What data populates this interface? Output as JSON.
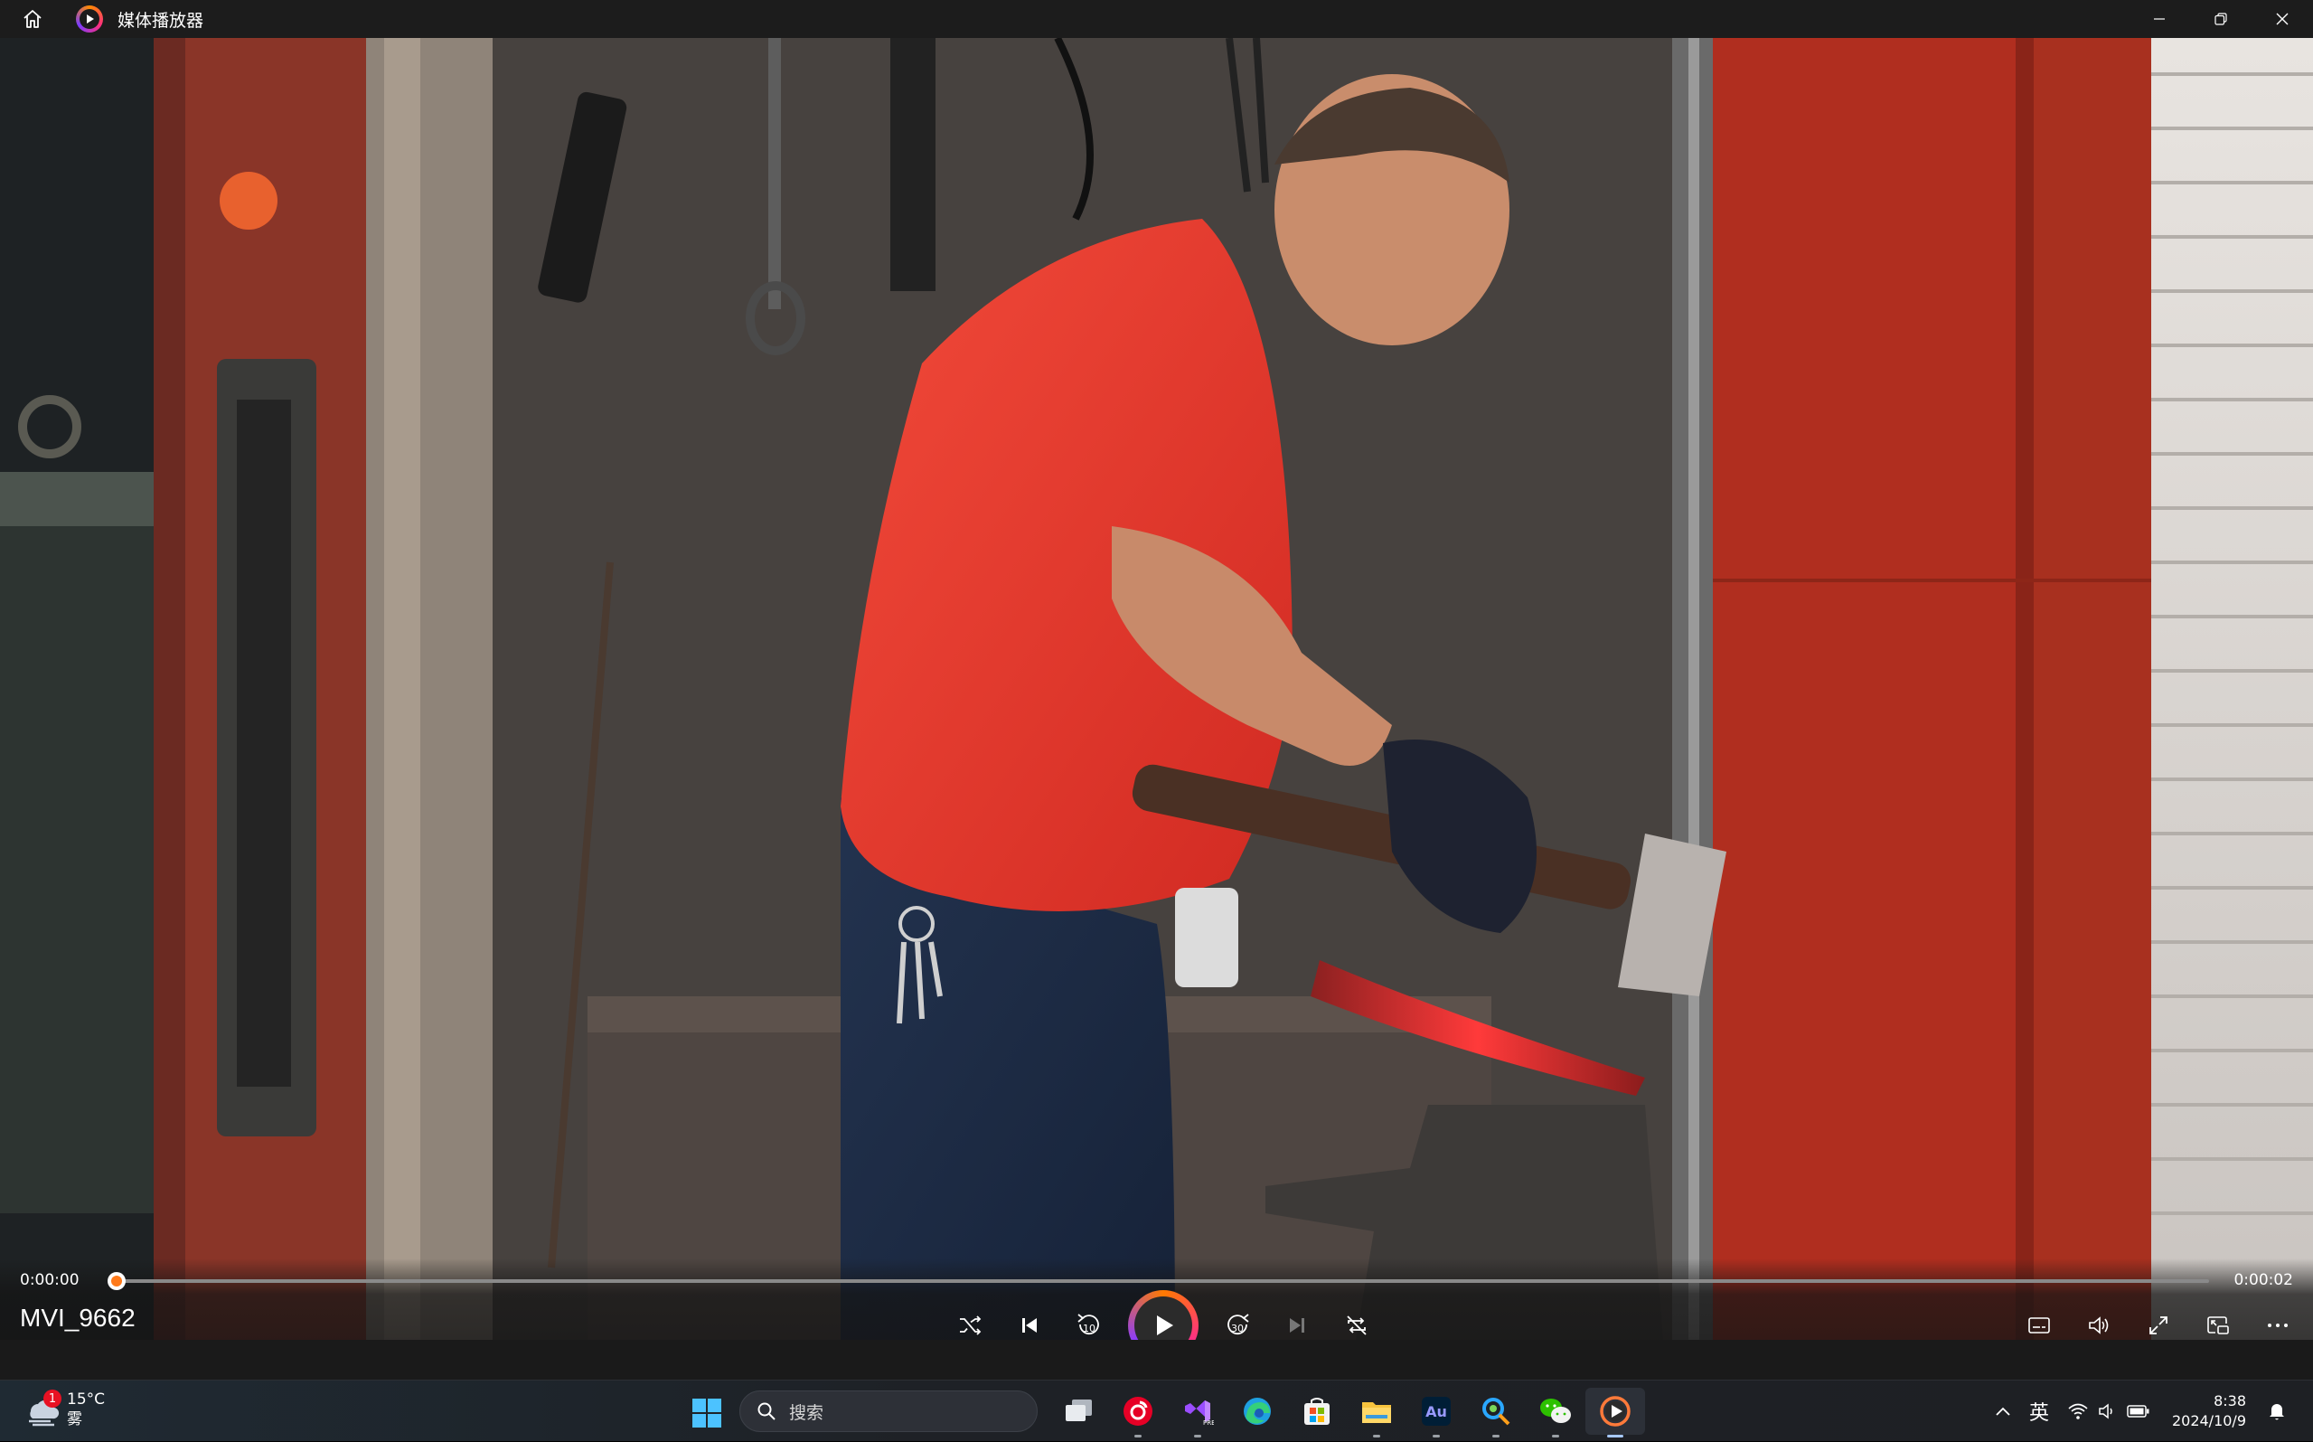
{
  "window": {
    "title": "媒体播放器",
    "icons": {
      "home": "home-icon",
      "app": "media-player-icon",
      "minimize": "minimize-icon",
      "maximize": "restore-icon",
      "close": "close-icon"
    }
  },
  "player": {
    "media_title": "MVI_9662",
    "current_time": "0:00:00",
    "total_time": "0:00:02",
    "progress": 0.0,
    "accent_color": "#ff7a1a",
    "controls": [
      {
        "name": "shuffle-button",
        "icon": "shuffle-icon"
      },
      {
        "name": "previous-button",
        "icon": "previous-icon"
      },
      {
        "name": "rewind-10-button",
        "icon": "rewind-10-icon",
        "label": "10"
      },
      {
        "name": "play-button",
        "icon": "play-icon"
      },
      {
        "name": "forward-30-button",
        "icon": "forward-30-icon",
        "label": "30"
      },
      {
        "name": "next-button",
        "icon": "next-icon"
      },
      {
        "name": "repeat-off-button",
        "icon": "repeat-off-icon"
      }
    ],
    "right_controls": [
      {
        "name": "captions-button",
        "icon": "captions-icon"
      },
      {
        "name": "volume-button",
        "icon": "volume-icon"
      },
      {
        "name": "fullscreen-button",
        "icon": "fullscreen-icon"
      },
      {
        "name": "miniplayer-button",
        "icon": "miniplayer-icon"
      },
      {
        "name": "more-options-button",
        "icon": "more-icon"
      }
    ]
  },
  "taskbar": {
    "weather": {
      "temperature": "15°C",
      "condition": "雾",
      "badge": "1"
    },
    "search_placeholder": "搜索",
    "apps": [
      "task-view",
      "netease-music",
      "visual-studio",
      "edge",
      "microsoft-store",
      "file-explorer",
      "audition",
      "search-app",
      "wechat",
      "media-player"
    ],
    "tray": {
      "language": "英",
      "time": "8:38",
      "date": "2024/10/9"
    }
  }
}
